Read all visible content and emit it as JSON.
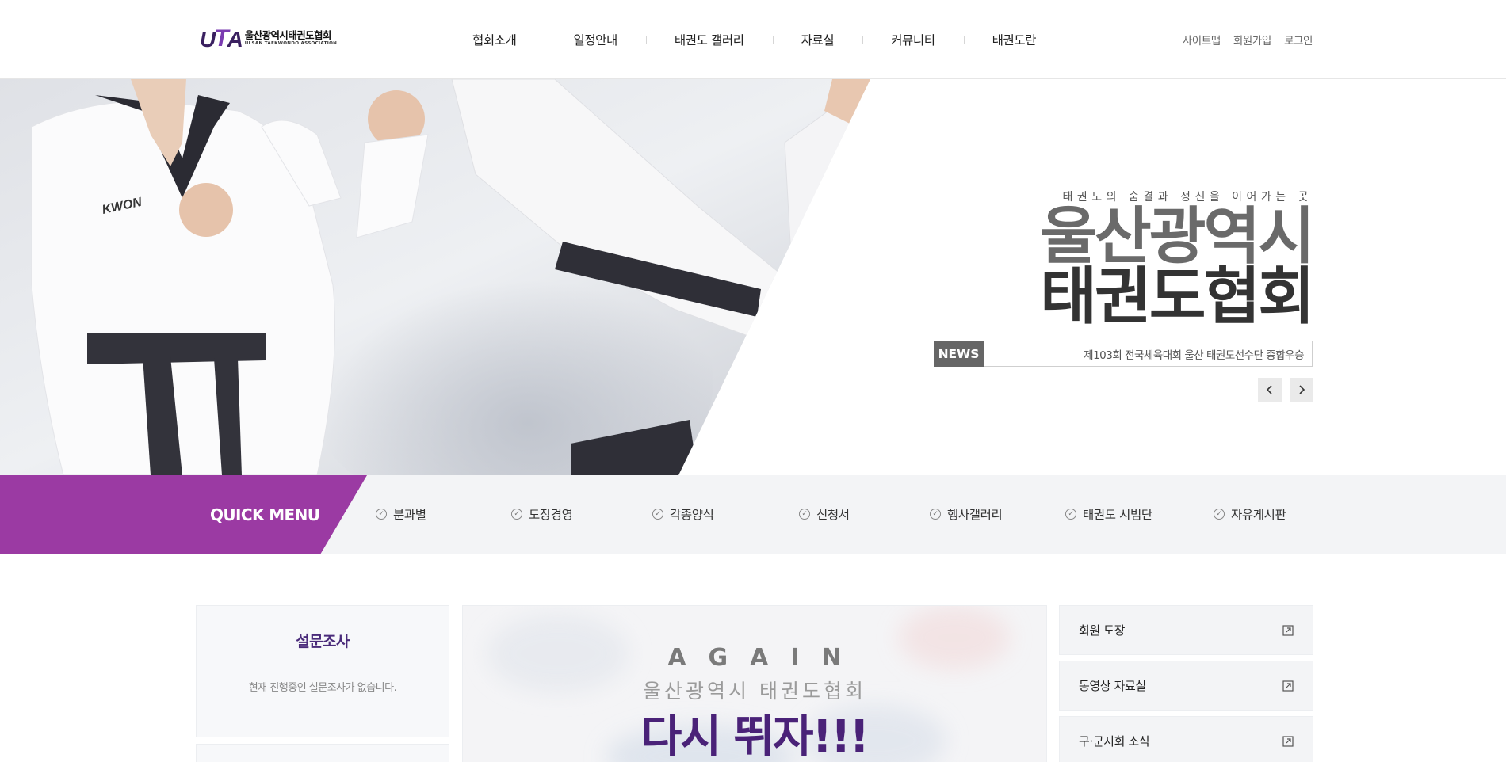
{
  "header": {
    "logo_mark": "UTA",
    "logo_ko": "울산광역시태권도협회",
    "logo_en": "ULSAN TAEKWONDO ASSOCIATION",
    "nav": [
      "협회소개",
      "일정안내",
      "태권도 갤러리",
      "자료실",
      "커뮤니티",
      "태권도란"
    ],
    "util": [
      "사이트맵",
      "회원가입",
      "로그인"
    ]
  },
  "hero": {
    "subtitle": "태권도의 숨결과 정신을 이어가는 곳",
    "title_line1": "울산광역시",
    "title_line2": "태권도협회",
    "news_label": "NEWS",
    "news_text": "제103회 전국체육대회 울산 태권도선수단 종합우승",
    "prev_icon": "chevron-left-icon",
    "next_icon": "chevron-right-icon"
  },
  "quick_menu": {
    "title": "QUICK MENU",
    "items": [
      "분과별",
      "도장경영",
      "각종양식",
      "신청서",
      "행사갤러리",
      "태권도 시범단",
      "자유게시판"
    ]
  },
  "survey": {
    "title": "설문조사",
    "desc": "현재 진행중인 설문조사가 없습니다."
  },
  "banner": {
    "again": "AGAIN",
    "sub": "울산광역시 태권도협회",
    "main": "다시 뛰자!!!"
  },
  "side_links": [
    "회원 도장",
    "동영상 자료실",
    "구·군지회 소식"
  ],
  "colors": {
    "brand_purple": "#9b3aa3",
    "dark_purple": "#4a2278",
    "news_gray": "#666666"
  }
}
